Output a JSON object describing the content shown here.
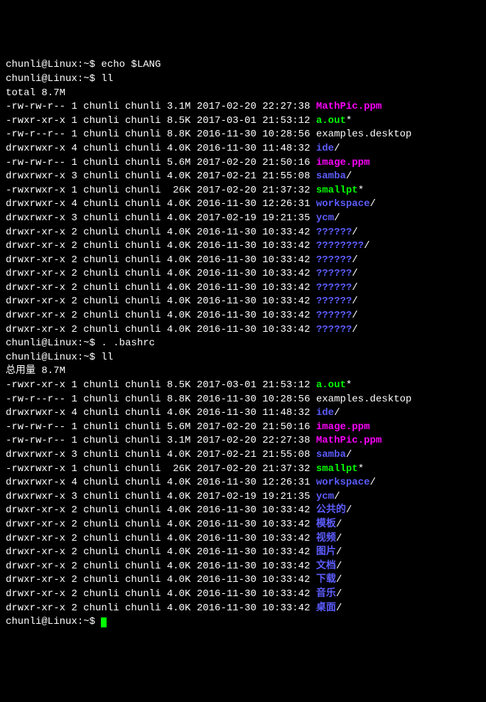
{
  "prompt": {
    "user": "chunli",
    "host": "Linux",
    "path": "~",
    "sep1": "@",
    "sep2": ":",
    "dollar": "$"
  },
  "cmds": {
    "echo_lang": "echo $LANG",
    "ll1": "ll",
    "source_bashrc": ". .bashrc",
    "ll2": "ll"
  },
  "empty": "",
  "total1": "total 8.7M",
  "total2": "总用量 8.7M",
  "list1": [
    {
      "perm": "-rw-rw-r--",
      "links": "1",
      "owner": "chunli",
      "group": "chunli",
      "size": "3.1M",
      "date": "2017-02-20",
      "time": "22:27:38",
      "name": "MathPic.ppm",
      "suffix": "",
      "cls": "magenta"
    },
    {
      "perm": "-rwxr-xr-x",
      "links": "1",
      "owner": "chunli",
      "group": "chunli",
      "size": "8.5K",
      "date": "2017-03-01",
      "time": "21:53:12",
      "name": "a.out",
      "suffix": "*",
      "cls": "green"
    },
    {
      "perm": "-rw-r--r--",
      "links": "1",
      "owner": "chunli",
      "group": "chunli",
      "size": "8.8K",
      "date": "2016-11-30",
      "time": "10:28:56",
      "name": "examples.desktop",
      "suffix": "",
      "cls": "white"
    },
    {
      "perm": "drwxrwxr-x",
      "links": "4",
      "owner": "chunli",
      "group": "chunli",
      "size": "4.0K",
      "date": "2016-11-30",
      "time": "11:48:32",
      "name": "ide",
      "suffix": "/",
      "cls": "blue"
    },
    {
      "perm": "-rw-rw-r--",
      "links": "1",
      "owner": "chunli",
      "group": "chunli",
      "size": "5.6M",
      "date": "2017-02-20",
      "time": "21:50:16",
      "name": "image.ppm",
      "suffix": "",
      "cls": "magenta"
    },
    {
      "perm": "drwxrwxr-x",
      "links": "3",
      "owner": "chunli",
      "group": "chunli",
      "size": "4.0K",
      "date": "2017-02-21",
      "time": "21:55:08",
      "name": "samba",
      "suffix": "/",
      "cls": "blue"
    },
    {
      "perm": "-rwxrwxr-x",
      "links": "1",
      "owner": "chunli",
      "group": "chunli",
      "size": " 26K",
      "date": "2017-02-20",
      "time": "21:37:32",
      "name": "smallpt",
      "suffix": "*",
      "cls": "green"
    },
    {
      "perm": "drwxrwxr-x",
      "links": "4",
      "owner": "chunli",
      "group": "chunli",
      "size": "4.0K",
      "date": "2016-11-30",
      "time": "12:26:31",
      "name": "workspace",
      "suffix": "/",
      "cls": "blue"
    },
    {
      "perm": "drwxrwxr-x",
      "links": "3",
      "owner": "chunli",
      "group": "chunli",
      "size": "4.0K",
      "date": "2017-02-19",
      "time": "19:21:35",
      "name": "ycm",
      "suffix": "/",
      "cls": "blue"
    },
    {
      "perm": "drwxr-xr-x",
      "links": "2",
      "owner": "chunli",
      "group": "chunli",
      "size": "4.0K",
      "date": "2016-11-30",
      "time": "10:33:42",
      "name": "??????",
      "suffix": "/",
      "cls": "blue"
    },
    {
      "perm": "drwxr-xr-x",
      "links": "2",
      "owner": "chunli",
      "group": "chunli",
      "size": "4.0K",
      "date": "2016-11-30",
      "time": "10:33:42",
      "name": "????????",
      "suffix": "/",
      "cls": "blue"
    },
    {
      "perm": "drwxr-xr-x",
      "links": "2",
      "owner": "chunli",
      "group": "chunli",
      "size": "4.0K",
      "date": "2016-11-30",
      "time": "10:33:42",
      "name": "??????",
      "suffix": "/",
      "cls": "blue"
    },
    {
      "perm": "drwxr-xr-x",
      "links": "2",
      "owner": "chunli",
      "group": "chunli",
      "size": "4.0K",
      "date": "2016-11-30",
      "time": "10:33:42",
      "name": "??????",
      "suffix": "/",
      "cls": "blue"
    },
    {
      "perm": "drwxr-xr-x",
      "links": "2",
      "owner": "chunli",
      "group": "chunli",
      "size": "4.0K",
      "date": "2016-11-30",
      "time": "10:33:42",
      "name": "??????",
      "suffix": "/",
      "cls": "blue"
    },
    {
      "perm": "drwxr-xr-x",
      "links": "2",
      "owner": "chunli",
      "group": "chunli",
      "size": "4.0K",
      "date": "2016-11-30",
      "time": "10:33:42",
      "name": "??????",
      "suffix": "/",
      "cls": "blue"
    },
    {
      "perm": "drwxr-xr-x",
      "links": "2",
      "owner": "chunli",
      "group": "chunli",
      "size": "4.0K",
      "date": "2016-11-30",
      "time": "10:33:42",
      "name": "??????",
      "suffix": "/",
      "cls": "blue"
    },
    {
      "perm": "drwxr-xr-x",
      "links": "2",
      "owner": "chunli",
      "group": "chunli",
      "size": "4.0K",
      "date": "2016-11-30",
      "time": "10:33:42",
      "name": "??????",
      "suffix": "/",
      "cls": "blue"
    }
  ],
  "list2": [
    {
      "perm": "-rwxr-xr-x",
      "links": "1",
      "owner": "chunli",
      "group": "chunli",
      "size": "8.5K",
      "date": "2017-03-01",
      "time": "21:53:12",
      "name": "a.out",
      "suffix": "*",
      "cls": "green"
    },
    {
      "perm": "-rw-r--r--",
      "links": "1",
      "owner": "chunli",
      "group": "chunli",
      "size": "8.8K",
      "date": "2016-11-30",
      "time": "10:28:56",
      "name": "examples.desktop",
      "suffix": "",
      "cls": "white"
    },
    {
      "perm": "drwxrwxr-x",
      "links": "4",
      "owner": "chunli",
      "group": "chunli",
      "size": "4.0K",
      "date": "2016-11-30",
      "time": "11:48:32",
      "name": "ide",
      "suffix": "/",
      "cls": "blue"
    },
    {
      "perm": "-rw-rw-r--",
      "links": "1",
      "owner": "chunli",
      "group": "chunli",
      "size": "5.6M",
      "date": "2017-02-20",
      "time": "21:50:16",
      "name": "image.ppm",
      "suffix": "",
      "cls": "magenta"
    },
    {
      "perm": "-rw-rw-r--",
      "links": "1",
      "owner": "chunli",
      "group": "chunli",
      "size": "3.1M",
      "date": "2017-02-20",
      "time": "22:27:38",
      "name": "MathPic.ppm",
      "suffix": "",
      "cls": "magenta"
    },
    {
      "perm": "drwxrwxr-x",
      "links": "3",
      "owner": "chunli",
      "group": "chunli",
      "size": "4.0K",
      "date": "2017-02-21",
      "time": "21:55:08",
      "name": "samba",
      "suffix": "/",
      "cls": "blue"
    },
    {
      "perm": "-rwxrwxr-x",
      "links": "1",
      "owner": "chunli",
      "group": "chunli",
      "size": " 26K",
      "date": "2017-02-20",
      "time": "21:37:32",
      "name": "smallpt",
      "suffix": "*",
      "cls": "green"
    },
    {
      "perm": "drwxrwxr-x",
      "links": "4",
      "owner": "chunli",
      "group": "chunli",
      "size": "4.0K",
      "date": "2016-11-30",
      "time": "12:26:31",
      "name": "workspace",
      "suffix": "/",
      "cls": "blue"
    },
    {
      "perm": "drwxrwxr-x",
      "links": "3",
      "owner": "chunli",
      "group": "chunli",
      "size": "4.0K",
      "date": "2017-02-19",
      "time": "19:21:35",
      "name": "ycm",
      "suffix": "/",
      "cls": "blue"
    },
    {
      "perm": "drwxr-xr-x",
      "links": "2",
      "owner": "chunli",
      "group": "chunli",
      "size": "4.0K",
      "date": "2016-11-30",
      "time": "10:33:42",
      "name": "公共的",
      "suffix": "/",
      "cls": "blue"
    },
    {
      "perm": "drwxr-xr-x",
      "links": "2",
      "owner": "chunli",
      "group": "chunli",
      "size": "4.0K",
      "date": "2016-11-30",
      "time": "10:33:42",
      "name": "模板",
      "suffix": "/",
      "cls": "blue"
    },
    {
      "perm": "drwxr-xr-x",
      "links": "2",
      "owner": "chunli",
      "group": "chunli",
      "size": "4.0K",
      "date": "2016-11-30",
      "time": "10:33:42",
      "name": "视频",
      "suffix": "/",
      "cls": "blue"
    },
    {
      "perm": "drwxr-xr-x",
      "links": "2",
      "owner": "chunli",
      "group": "chunli",
      "size": "4.0K",
      "date": "2016-11-30",
      "time": "10:33:42",
      "name": "图片",
      "suffix": "/",
      "cls": "blue"
    },
    {
      "perm": "drwxr-xr-x",
      "links": "2",
      "owner": "chunli",
      "group": "chunli",
      "size": "4.0K",
      "date": "2016-11-30",
      "time": "10:33:42",
      "name": "文档",
      "suffix": "/",
      "cls": "blue"
    },
    {
      "perm": "drwxr-xr-x",
      "links": "2",
      "owner": "chunli",
      "group": "chunli",
      "size": "4.0K",
      "date": "2016-11-30",
      "time": "10:33:42",
      "name": "下载",
      "suffix": "/",
      "cls": "blue"
    },
    {
      "perm": "drwxr-xr-x",
      "links": "2",
      "owner": "chunli",
      "group": "chunli",
      "size": "4.0K",
      "date": "2016-11-30",
      "time": "10:33:42",
      "name": "音乐",
      "suffix": "/",
      "cls": "blue"
    },
    {
      "perm": "drwxr-xr-x",
      "links": "2",
      "owner": "chunli",
      "group": "chunli",
      "size": "4.0K",
      "date": "2016-11-30",
      "time": "10:33:42",
      "name": "桌面",
      "suffix": "/",
      "cls": "blue"
    }
  ]
}
